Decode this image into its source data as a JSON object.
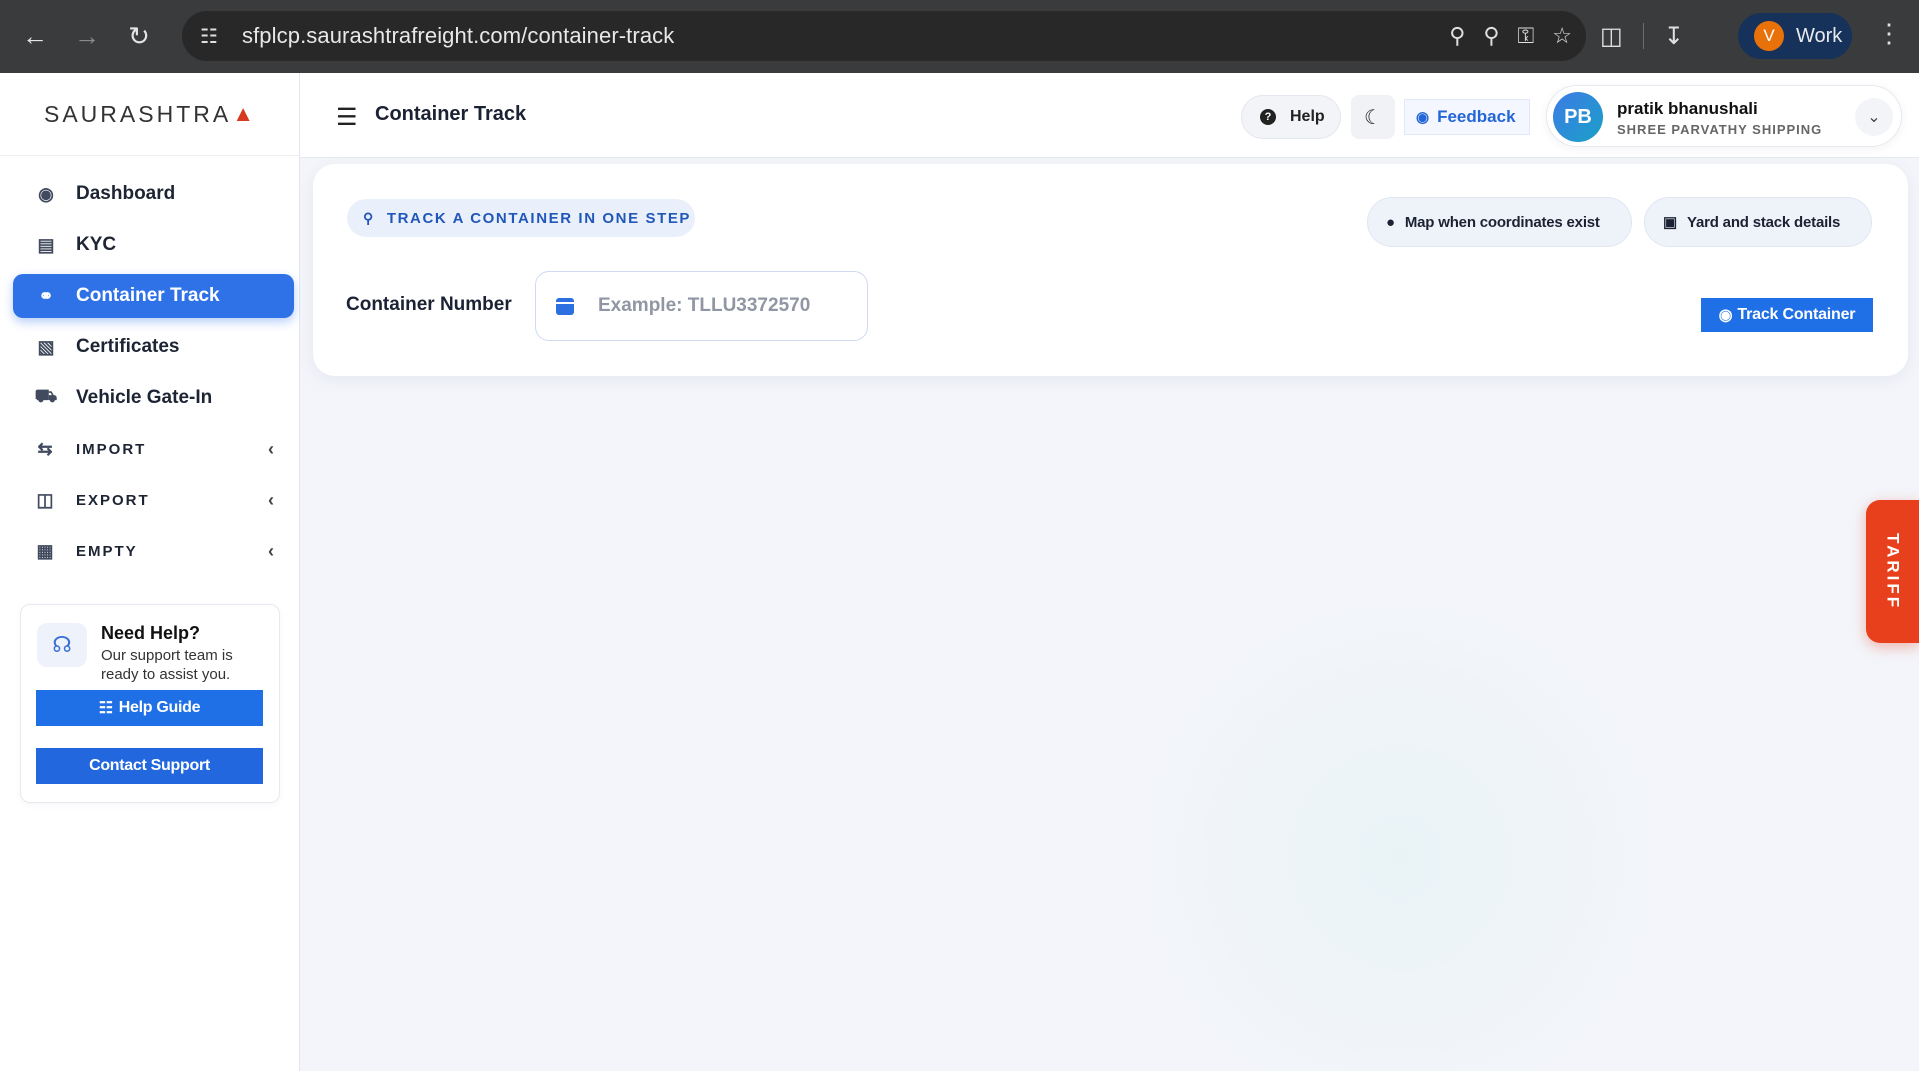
{
  "browser": {
    "url": "sfplcp.saurashtrafreight.com/container-track",
    "profile_initial": "V",
    "profile_name": "Work"
  },
  "sidebar": {
    "logo": "SAURASHTRA",
    "items": [
      {
        "label": "Dashboard",
        "icon": "dashboard-icon"
      },
      {
        "label": "KYC",
        "icon": "id-card-icon"
      },
      {
        "label": "Container Track",
        "icon": "route-icon",
        "active": true
      },
      {
        "label": "Certificates",
        "icon": "certificate-icon"
      },
      {
        "label": "Vehicle Gate-In",
        "icon": "truck-icon"
      }
    ],
    "groups": [
      {
        "label": "IMPORT",
        "icon": "arrows-swap-icon"
      },
      {
        "label": "EXPORT",
        "icon": "file-export-icon"
      },
      {
        "label": "EMPTY",
        "icon": "boxes-icon"
      }
    ],
    "help_card": {
      "title": "Need Help?",
      "subtitle": "Our support team is ready to assist you.",
      "guide_label": "Help Guide",
      "contact_label": "Contact Support"
    }
  },
  "header": {
    "title": "Container Track",
    "help_label": "Help",
    "feedback_label": "Feedback",
    "user": {
      "initials": "PB",
      "name": "pratik bhanushali",
      "company": "SHREE PARVATHY SHIPPING"
    }
  },
  "track": {
    "badge": "TRACK A CONTAINER IN ONE STEP",
    "feature_map": "Map when coordinates exist",
    "feature_yard": "Yard and stack details",
    "field_label": "Container Number",
    "placeholder": "Example: TLLU3372570",
    "value": "",
    "button_label": "Track Container"
  },
  "tariff_label": "TARIFF",
  "colors": {
    "primary": "#1f6fe6",
    "active_nav": "#2f72e8",
    "tariff": "#e8401c"
  }
}
